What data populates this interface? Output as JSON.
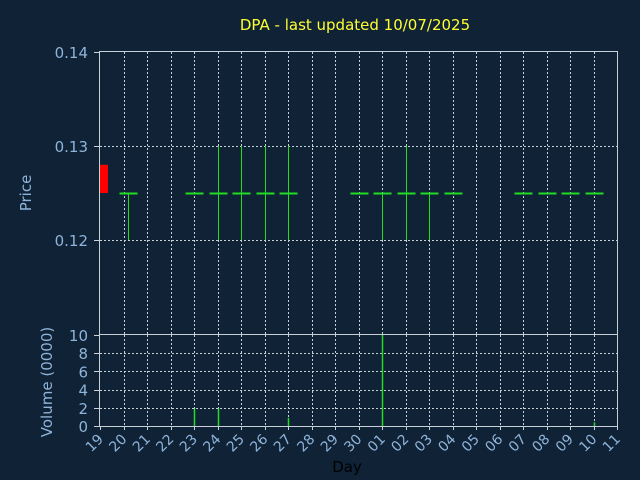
{
  "chart_data": {
    "title": "DPA - last updated 10/07/2025",
    "xlabel": "Day",
    "x_categories": [
      "19",
      "20",
      "21",
      "22",
      "23",
      "24",
      "25",
      "26",
      "27",
      "28",
      "29",
      "30",
      "01",
      "02",
      "03",
      "04",
      "05",
      "06",
      "07",
      "08",
      "09",
      "10",
      "11"
    ],
    "price_panel": {
      "type": "ohlc",
      "ylabel": "Price",
      "ylim": [
        0.11,
        0.14
      ],
      "yticks": [
        "0.12",
        "0.13",
        "0.14"
      ],
      "ytick_values": [
        0.12,
        0.13,
        0.14
      ],
      "colors": {
        "bars": "#22dd22",
        "last_close_marker": "#ff0000"
      },
      "bars": [
        {
          "x": 20.2,
          "high": 0.125,
          "low": 0.12,
          "close": 0.125
        },
        {
          "x": 23.0,
          "high": 0.125,
          "low": 0.125,
          "close": 0.125
        },
        {
          "x": 24.0,
          "high": 0.13,
          "low": 0.12,
          "close": 0.125
        },
        {
          "x": 25.0,
          "high": 0.13,
          "low": 0.12,
          "close": 0.125
        },
        {
          "x": 26.0,
          "high": 0.13,
          "low": 0.12,
          "close": 0.125
        },
        {
          "x": 27.0,
          "high": 0.13,
          "low": 0.12,
          "close": 0.125
        },
        {
          "x": 30.0,
          "high": 0.125,
          "low": 0.125,
          "close": 0.125
        },
        {
          "x": 31.0,
          "high": 0.125,
          "low": 0.12,
          "close": 0.125
        },
        {
          "x": 32.0,
          "high": 0.13,
          "low": 0.12,
          "close": 0.125
        },
        {
          "x": 33.0,
          "high": 0.125,
          "low": 0.12,
          "close": 0.125
        },
        {
          "x": 34.0,
          "high": 0.125,
          "low": 0.125,
          "close": 0.125
        },
        {
          "x": 37.0,
          "high": 0.125,
          "low": 0.125,
          "close": 0.125
        },
        {
          "x": 38.0,
          "high": 0.125,
          "low": 0.125,
          "close": 0.125
        },
        {
          "x": 39.0,
          "high": 0.125,
          "low": 0.125,
          "close": 0.125
        },
        {
          "x": 40.0,
          "high": 0.125,
          "low": 0.125,
          "close": 0.125
        }
      ],
      "last_close_marker": {
        "x": 19.0,
        "low": 0.125,
        "high": 0.128
      }
    },
    "volume_panel": {
      "type": "bar",
      "ylabel": "Volume (0000)",
      "ylim": [
        0,
        10
      ],
      "yticks": [
        "0",
        "2",
        "4",
        "6",
        "8",
        "10"
      ],
      "ytick_values": [
        0,
        2,
        4,
        6,
        8,
        10
      ],
      "color": "#22dd22",
      "bars": [
        {
          "x": 23.0,
          "value": 1.9
        },
        {
          "x": 24.0,
          "value": 1.9
        },
        {
          "x": 27.0,
          "value": 0.9
        },
        {
          "x": 31.0,
          "value": 10.0
        },
        {
          "x": 40.0,
          "value": 0.4
        }
      ]
    }
  }
}
